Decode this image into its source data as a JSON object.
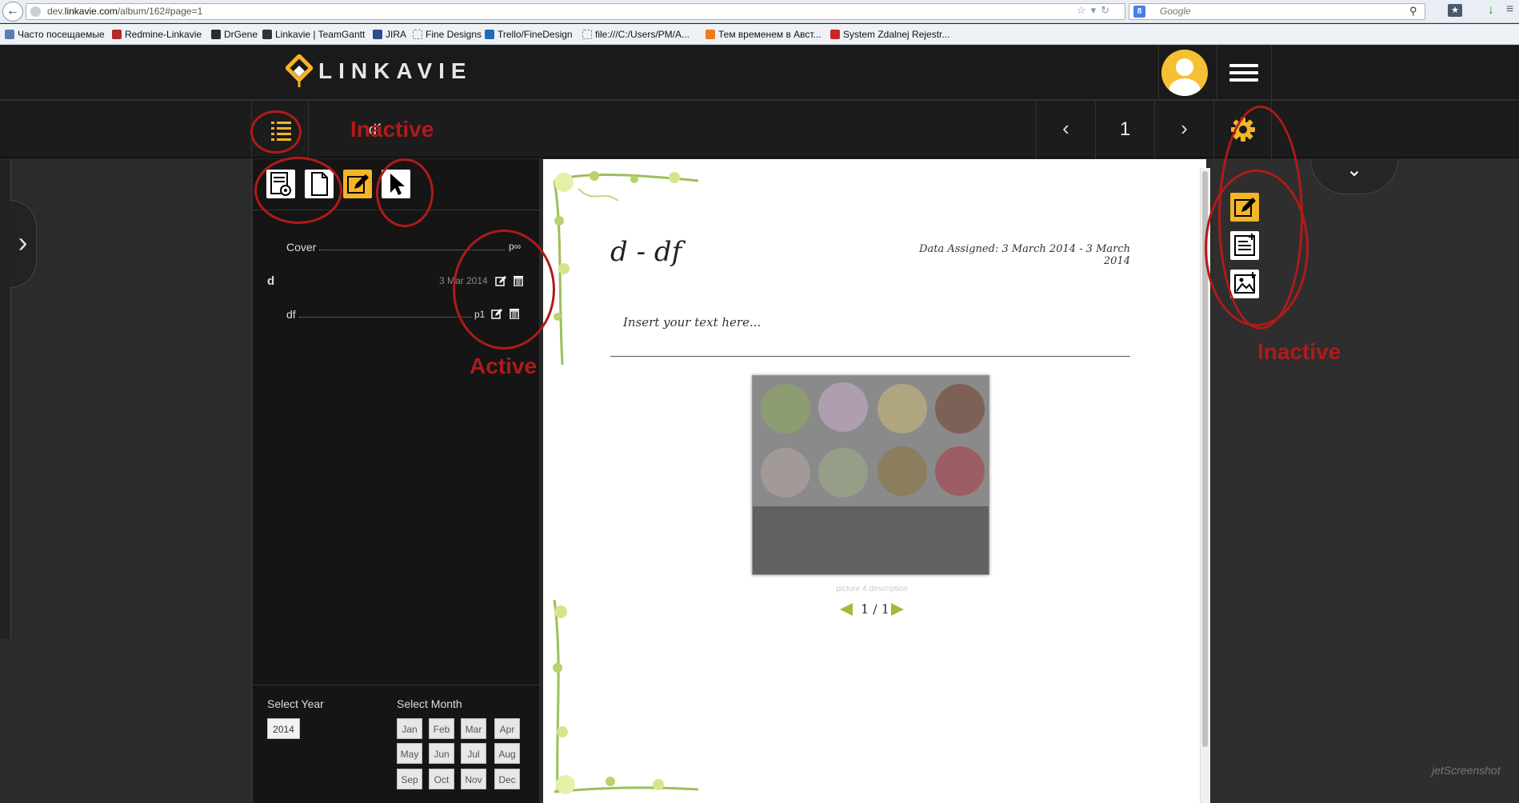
{
  "browser": {
    "url_prefix": "dev.",
    "url_host": "linkavie.com",
    "url_path": "/album/162#page=1",
    "search_placeholder": "Google",
    "search_engine_letter": "8",
    "bookmarks": [
      {
        "label": "Часто посещаемые",
        "icon_color": "#5a7db8"
      },
      {
        "label": "Redmine-Linkavie",
        "icon_color": "#b42a2a"
      },
      {
        "label": "DrGene",
        "icon_color": "#2a2a2a"
      },
      {
        "label": "Linkavie | TeamGantt",
        "icon_color": "#333333"
      },
      {
        "label": "JIRA",
        "icon_color": "#2b4e8c"
      },
      {
        "label": "Fine Designs",
        "icon_color": "#cccccc"
      },
      {
        "label": "Trello/FineDesign",
        "icon_color": "#1f6db5"
      },
      {
        "label": "file:///C:/Users/PM/A...",
        "icon_color": "#cccccc"
      },
      {
        "label": "Тем временем в Авст...",
        "icon_color": "#f07a1a"
      },
      {
        "label": "System Zdalnej Rejestr...",
        "icon_color": "#d0222a"
      }
    ]
  },
  "header": {
    "logo_text": "LINKAVIE",
    "accent_color": "#f4b526"
  },
  "toolbar": {
    "title": "df",
    "prev_icon": "‹",
    "page_number": "1",
    "next_icon": "›"
  },
  "left_tab_icon": "›",
  "right_tab_icon": "⌄",
  "toc": {
    "cover_label": "Cover",
    "cover_page": "p∞",
    "chapter_label": "d",
    "chapter_date": "3 Mar 2014",
    "item_label": "df",
    "item_page": "p1"
  },
  "selectors": {
    "year_label": "Select Year",
    "month_label": "Select Month",
    "years": [
      "2014"
    ],
    "months": [
      "Jan",
      "Feb",
      "Mar",
      "Apr",
      "May",
      "Jun",
      "Jul",
      "Aug",
      "Sep",
      "Oct",
      "Nov",
      "Dec"
    ]
  },
  "page": {
    "heading": "d - df",
    "date_assigned": "Data Assigned: 3 March 2014 - 3 March 2014",
    "text_placeholder": "Insert your text here...",
    "gallery_caption": "picture 4 description",
    "gallery_count": "1 / 1"
  },
  "annotations": {
    "toolbar_inactive": "Inactive",
    "sidebar_active": "Active",
    "right_inactive": "Inactive",
    "color": "#b01a1a"
  },
  "watermark": "jetScreenshot"
}
